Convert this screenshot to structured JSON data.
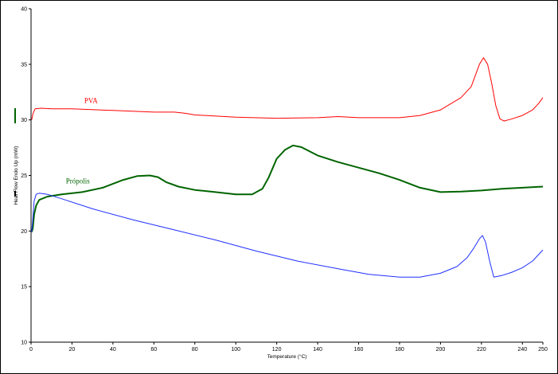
{
  "chart_data": {
    "type": "line",
    "title": "",
    "xlabel": "Temperature (°C)",
    "ylabel": "Heat Flow Endo Up (mW)",
    "xlim": [
      0,
      250
    ],
    "ylim": [
      10,
      40
    ],
    "x_ticks": [
      "0",
      "20",
      "40",
      "60",
      "80",
      "100",
      "120",
      "140",
      "160",
      "180",
      "200",
      "220",
      "240",
      "250"
    ],
    "y_ticks": [
      "10",
      "15",
      "20",
      "25",
      "30",
      "35",
      "40"
    ],
    "grid": false,
    "legend": "none",
    "series": [
      {
        "name": "PVA",
        "color": "#ff0000",
        "points": [
          [
            0.3,
            30
          ],
          [
            1,
            30.6
          ],
          [
            2,
            31
          ],
          [
            5,
            31.05
          ],
          [
            10,
            31
          ],
          [
            20,
            31
          ],
          [
            40,
            30.85
          ],
          [
            60,
            30.7
          ],
          [
            70,
            30.7
          ],
          [
            75,
            30.6
          ],
          [
            80,
            30.45
          ],
          [
            100,
            30.25
          ],
          [
            120,
            30.15
          ],
          [
            140,
            30.2
          ],
          [
            150,
            30.3
          ],
          [
            160,
            30.2
          ],
          [
            180,
            30.2
          ],
          [
            190,
            30.4
          ],
          [
            200,
            30.9
          ],
          [
            210,
            32
          ],
          [
            215,
            33
          ],
          [
            219,
            35
          ],
          [
            221,
            35.6
          ],
          [
            223,
            35
          ],
          [
            225,
            33.3
          ],
          [
            227,
            31.3
          ],
          [
            229,
            30.1
          ],
          [
            231,
            29.9
          ],
          [
            235,
            30.1
          ],
          [
            240,
            30.4
          ],
          [
            245,
            30.9
          ],
          [
            248,
            31.5
          ],
          [
            250,
            32
          ]
        ]
      },
      {
        "name": "Própolis",
        "color": "#006400",
        "points": [
          [
            0.3,
            19.9
          ],
          [
            0.8,
            20.2
          ],
          [
            1.5,
            21.5
          ],
          [
            2.5,
            22.3
          ],
          [
            4,
            22.8
          ],
          [
            8,
            23.1
          ],
          [
            15,
            23.3
          ],
          [
            25,
            23.5
          ],
          [
            35,
            23.9
          ],
          [
            45,
            24.6
          ],
          [
            52,
            24.95
          ],
          [
            58,
            25
          ],
          [
            62,
            24.85
          ],
          [
            66,
            24.4
          ],
          [
            72,
            24
          ],
          [
            80,
            23.7
          ],
          [
            90,
            23.5
          ],
          [
            100,
            23.3
          ],
          [
            108,
            23.3
          ],
          [
            113,
            23.8
          ],
          [
            116,
            24.8
          ],
          [
            120,
            26.5
          ],
          [
            124,
            27.3
          ],
          [
            128,
            27.7
          ],
          [
            132,
            27.55
          ],
          [
            140,
            26.8
          ],
          [
            150,
            26.2
          ],
          [
            160,
            25.7
          ],
          [
            170,
            25.2
          ],
          [
            180,
            24.6
          ],
          [
            190,
            23.9
          ],
          [
            200,
            23.5
          ],
          [
            210,
            23.55
          ],
          [
            220,
            23.65
          ],
          [
            230,
            23.8
          ],
          [
            240,
            23.9
          ],
          [
            250,
            24
          ]
        ]
      },
      {
        "name": "",
        "color": "#2030ff",
        "points": [
          [
            0.3,
            19.9
          ],
          [
            0.8,
            21
          ],
          [
            1.5,
            22.7
          ],
          [
            2.5,
            23.3
          ],
          [
            4,
            23.4
          ],
          [
            8,
            23.3
          ],
          [
            15,
            22.9
          ],
          [
            30,
            22
          ],
          [
            50,
            21
          ],
          [
            70,
            20.1
          ],
          [
            90,
            19.2
          ],
          [
            110,
            18.2
          ],
          [
            130,
            17.3
          ],
          [
            150,
            16.6
          ],
          [
            165,
            16.1
          ],
          [
            180,
            15.85
          ],
          [
            190,
            15.85
          ],
          [
            200,
            16.2
          ],
          [
            208,
            16.8
          ],
          [
            213,
            17.6
          ],
          [
            216,
            18.4
          ],
          [
            219,
            19.3
          ],
          [
            220.5,
            19.6
          ],
          [
            222,
            19
          ],
          [
            224,
            17.3
          ],
          [
            226,
            15.85
          ],
          [
            230,
            16
          ],
          [
            235,
            16.3
          ],
          [
            240,
            16.7
          ],
          [
            245,
            17.3
          ],
          [
            250,
            18.3
          ]
        ]
      }
    ],
    "annotations": [
      {
        "text": "PVA",
        "x": 26,
        "y": 31.5,
        "color": "#ff0000"
      },
      {
        "text": "Própolis",
        "x": 17,
        "y": 24.3,
        "color": "#006400"
      }
    ],
    "y_marker_color": "#006400"
  }
}
